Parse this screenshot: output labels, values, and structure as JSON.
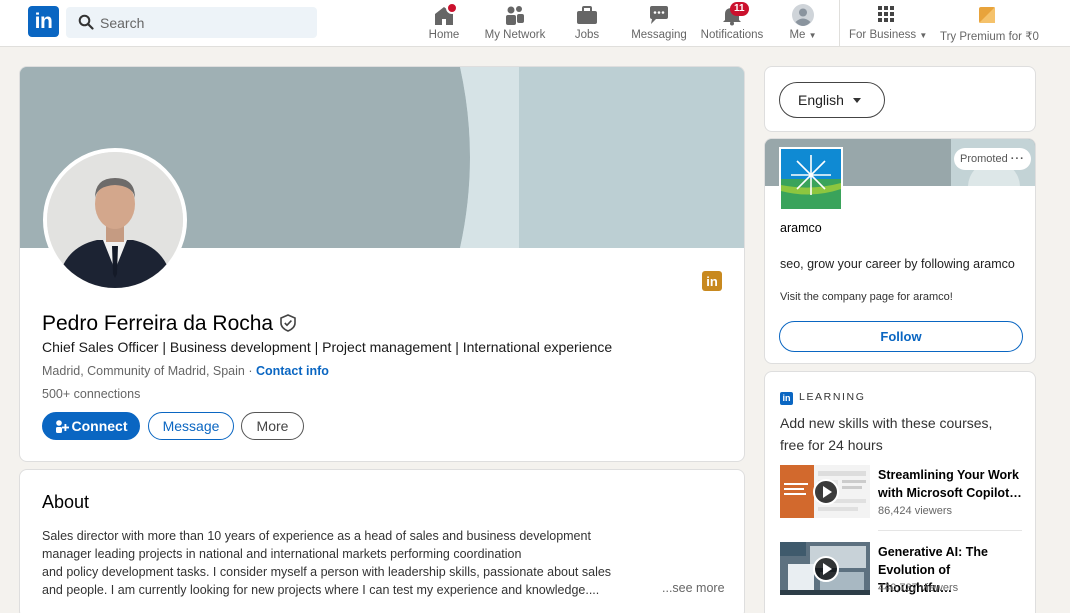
{
  "nav": {
    "logo": "in",
    "search_placeholder": "Search",
    "items": [
      {
        "label": "Home",
        "icon": "home-icon"
      },
      {
        "label": "My Network",
        "icon": "network-icon"
      },
      {
        "label": "Jobs",
        "icon": "briefcase-icon"
      },
      {
        "label": "Messaging",
        "icon": "messaging-icon"
      },
      {
        "label": "Notifications",
        "icon": "bell-icon",
        "badge": "11"
      },
      {
        "label": "Me",
        "icon": "avatar-icon"
      },
      {
        "label": "For Business",
        "icon": "grid-icon"
      },
      {
        "label": "Try Premium for ₹0",
        "icon": "premium-icon"
      }
    ]
  },
  "profile": {
    "name": "Pedro Ferreira da Rocha",
    "headline": "Chief Sales Officer | Business development | Project management | International experience",
    "location": "Madrid, Community of Madrid, Spain",
    "location_sep": " · ",
    "contact_info": "Contact info",
    "connections": "500+ connections",
    "badge_logo": "in",
    "buttons": {
      "connect": "Connect",
      "message": "Message",
      "more": "More"
    }
  },
  "about": {
    "title": "About",
    "lines": [
      "Sales director with more than 10 years of experience as a head of sales and business development",
      "manager leading projects in national and international markets performing coordination",
      "and policy development tasks. I consider myself a person with leadership skills, passionate about sales",
      "and people. I am currently looking for new projects where I can test my experience and knowledge...."
    ],
    "see_more": "...see more"
  },
  "language": {
    "selected": "English"
  },
  "ad": {
    "promoted": "Promoted",
    "company": "aramco",
    "text": "seo, grow your career by following aramco",
    "sub": "Visit the company page for aramco!",
    "follow": "Follow"
  },
  "learning": {
    "logo": "in",
    "header": "LEARNING",
    "title": "Add new skills with these courses, free for 24 hours",
    "courses": [
      {
        "title": "Streamlining Your Work with Microsoft Copilot…",
        "viewers": "86,424 viewers"
      },
      {
        "title": "Generative AI: The Evolution of Thoughtfu…",
        "viewers": "440,737 viewers"
      }
    ]
  },
  "colors": {
    "brand": "#0a66c2",
    "notification": "#cb112d",
    "premium": "#e8a33b"
  }
}
